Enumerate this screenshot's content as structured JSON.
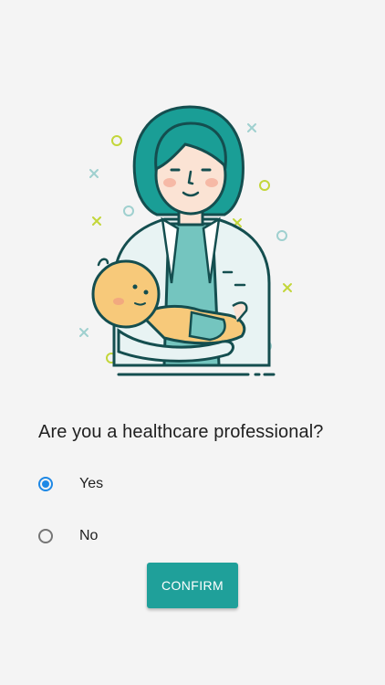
{
  "illustration": {
    "icon": "doctor-holding-baby-illustration"
  },
  "question": "Are you a healthcare professional?",
  "options": [
    {
      "label": "Yes",
      "selected": true
    },
    {
      "label": "No",
      "selected": false
    }
  ],
  "confirm_label": "CONFIRM",
  "colors": {
    "accent": "#1fa09a",
    "radio_selected": "#1e88e5",
    "background": "#f4f4f4",
    "text": "#212121"
  }
}
